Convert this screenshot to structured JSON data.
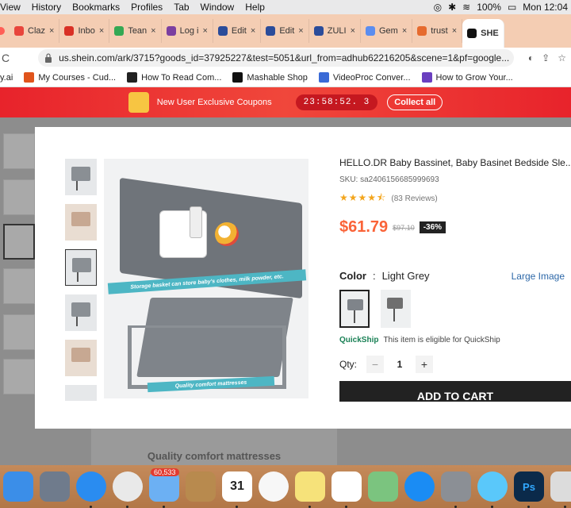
{
  "menubar": {
    "items": [
      "View",
      "History",
      "Bookmarks",
      "Profiles",
      "Tab",
      "Window",
      "Help"
    ],
    "battery": "100%",
    "clock": "Mon 12:04"
  },
  "tabs": [
    {
      "label": "Claz",
      "color": "#e8453c"
    },
    {
      "label": "Inbo",
      "color": "#d93025"
    },
    {
      "label": "Tean",
      "color": "#34a853"
    },
    {
      "label": "Log i",
      "color": "#7b3fa0"
    },
    {
      "label": "Edit",
      "color": "#2b4c9a"
    },
    {
      "label": "Edit",
      "color": "#2b4c9a"
    },
    {
      "label": "ZULI",
      "color": "#2b4c9a"
    },
    {
      "label": "Gem",
      "color": "#5b8def"
    },
    {
      "label": "trust",
      "color": "#e66b2e"
    },
    {
      "label": "SHE",
      "color": "#111111"
    }
  ],
  "address": {
    "url": "us.shein.com/ark/3715?goods_id=37925227&test=5051&url_from=adhub62216205&scene=1&pf=google..."
  },
  "bookmarks": [
    {
      "label": "y.ai",
      "color": "#6b8f3a"
    },
    {
      "label": "My Courses - Cud...",
      "color": "#e0541c"
    },
    {
      "label": "How To Read Com...",
      "color": "#222222"
    },
    {
      "label": "Mashable Shop",
      "color": "#111111"
    },
    {
      "label": "VideoProc Conver...",
      "color": "#3a6ad6"
    },
    {
      "label": "How to Grow Your...",
      "color": "#6a3fbf"
    }
  ],
  "promo": {
    "text": "New User Exclusive Coupons",
    "timer": "23:58:52. 3",
    "collect": "Collect all"
  },
  "background": {
    "caption": "Quality comfort mattresses"
  },
  "product": {
    "title": "HELLO.DR Baby Bassinet, Baby Basinet Bedside Sle...",
    "sku": "SKU: sa2406156685999693",
    "rating": 4.5,
    "reviews": "(83 Reviews)",
    "price": "$61.79",
    "old_price": "$97.10",
    "discount": "-36%",
    "color_label": "Color",
    "color_sep": ":",
    "color_value": "Light Grey",
    "large_image": "Large Image",
    "quickship": "QuickShip",
    "quickship_desc": "This item is eligible for QuickShip",
    "qty_label": "Qty:",
    "qty_value": "1",
    "qty_minus": "−",
    "qty_plus": "+",
    "add_to_cart": "ADD TO CART",
    "image_caption_1": "Storage basket can store baby's clothes, milk powder, etc.",
    "image_caption_2": "Quality comfort mattresses"
  },
  "dock": [
    {
      "name": "finder",
      "color": "#3b8ee8",
      "label": ""
    },
    {
      "name": "launchpad",
      "color": "#6f7b8c",
      "label": ""
    },
    {
      "name": "safari",
      "color": "#2a8cf0",
      "label": ""
    },
    {
      "name": "chrome",
      "color": "#e9e9e9",
      "label": ""
    },
    {
      "name": "mail",
      "color": "#6cb0f3",
      "label": "",
      "badge": "60,533"
    },
    {
      "name": "notefile",
      "color": "#b88a4e",
      "label": ""
    },
    {
      "name": "calendar",
      "color": "#ffffff",
      "label": "31"
    },
    {
      "name": "photos",
      "color": "#f7f7f7",
      "label": ""
    },
    {
      "name": "notes",
      "color": "#f6e27a",
      "label": ""
    },
    {
      "name": "reminders",
      "color": "#ffffff",
      "label": ""
    },
    {
      "name": "maps",
      "color": "#7bc47f",
      "label": ""
    },
    {
      "name": "app-store",
      "color": "#1a8cf4",
      "label": ""
    },
    {
      "name": "system-preferences",
      "color": "#8b8f95",
      "label": ""
    },
    {
      "name": "messages",
      "color": "#5ac8fa",
      "label": ""
    },
    {
      "name": "photoshop",
      "color": "#0b2a4a",
      "label": "Ps"
    },
    {
      "name": "preview",
      "color": "#dcdcdc",
      "label": ""
    }
  ]
}
